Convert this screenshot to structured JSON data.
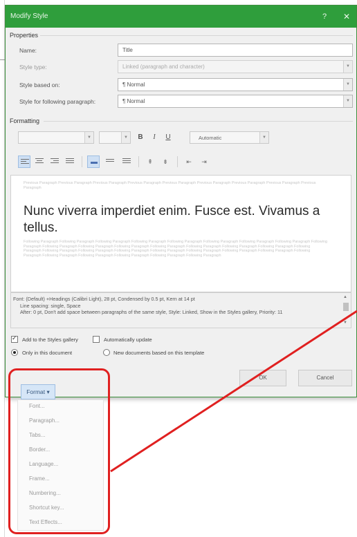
{
  "dialog": {
    "title": "Modify Style",
    "help_glyph": "?",
    "close_glyph": "✕"
  },
  "properties": {
    "section_label": "Properties",
    "name_label": "Name:",
    "name_value": "Title",
    "style_type_label": "Style type:",
    "style_type_value": "Linked (paragraph and character)",
    "based_on_label": "Style based on:",
    "based_on_value": "¶ Normal",
    "following_label": "Style for following paragraph:",
    "following_value": "¶ Normal"
  },
  "formatting": {
    "section_label": "Formatting",
    "bold": "B",
    "italic": "I",
    "underline": "U",
    "color_value": "Automatic"
  },
  "preview": {
    "previous_text": "Previous Paragraph Previous Paragraph Previous Paragraph Previous Paragraph Previous Paragraph Previous Paragraph Previous Paragraph Previous Paragraph Previous Paragraph",
    "sample_text": "Nunc viverra imperdiet enim. Fusce est. Vivamus a tellus.",
    "following_text": "Following Paragraph Following Paragraph Following Paragraph Following Paragraph Following Paragraph Following Paragraph Following Paragraph Following Paragraph Following Paragraph Following Paragraph Following Paragraph Following Paragraph Following Paragraph Following Paragraph Following Paragraph Following Paragraph Following Paragraph Following Paragraph Following Paragraph Following Paragraph Following Paragraph Following Paragraph Following Paragraph Following Paragraph Following Paragraph Following Paragraph Following Paragraph Following Paragraph Following Paragraph Following Paragraph"
  },
  "description": {
    "line1": "Font: (Default) +Headings (Calibri Light), 28 pt, Condensed by 0.5 pt, Kern at 14 pt",
    "line2": "Line spacing: single, Space",
    "line3": "After: 0 pt, Don't add space between paragraphs of the same style, Style: Linked, Show in the Styles gallery, Priority: 11"
  },
  "options": {
    "add_gallery_label": "Add to the Styles gallery",
    "add_gallery_checked": true,
    "auto_update_label": "Automatically update",
    "auto_update_checked": false,
    "only_doc_label": "Only in this document",
    "new_docs_label": "New documents based on this template",
    "selected_scope": "only_doc"
  },
  "buttons": {
    "format_label": "Format ▾",
    "ok_label": "OK",
    "cancel_label": "Cancel"
  },
  "format_menu": {
    "items": [
      "Font...",
      "Paragraph...",
      "Tabs...",
      "Border...",
      "Language...",
      "Frame...",
      "Numbering...",
      "Shortcut key...",
      "Text Effects..."
    ]
  },
  "colors": {
    "title_bar": "#2f9e3c",
    "highlight": "#e02020",
    "active_toggle": "#cfe0f4"
  }
}
